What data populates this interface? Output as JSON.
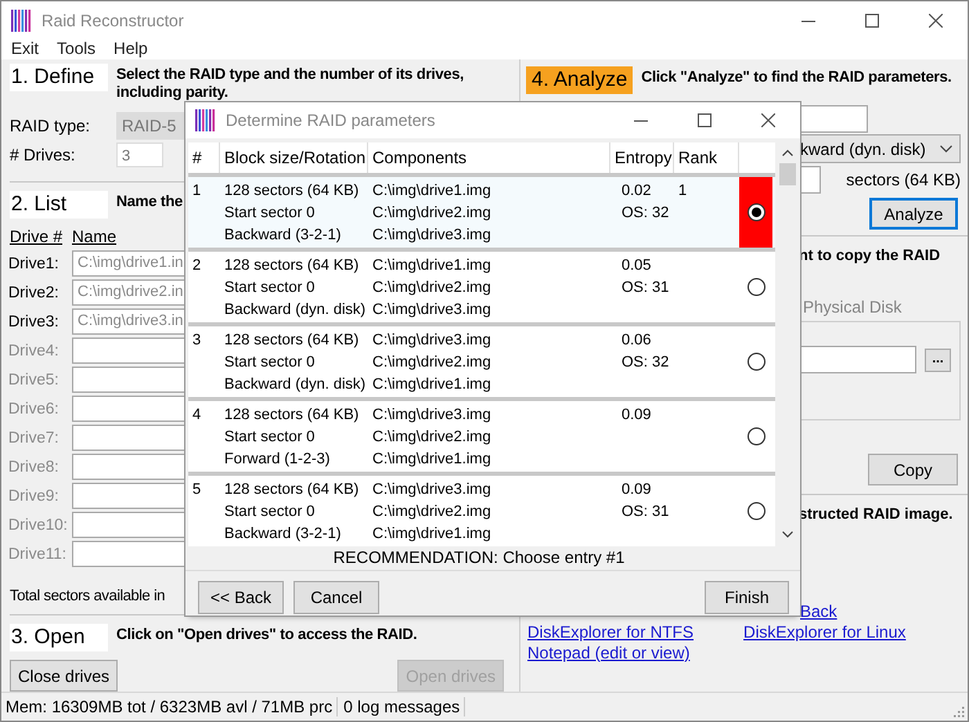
{
  "window": {
    "title": "Raid Reconstructor"
  },
  "menu": [
    "Exit",
    "Tools",
    "Help"
  ],
  "define": {
    "step": "1. Define",
    "instruction": "Select the RAID type and the number of its drives, including parity.",
    "raid_type": {
      "label": "RAID type:",
      "value": "RAID-5"
    },
    "drive_count": {
      "label": "# Drives:",
      "value": "3"
    }
  },
  "list": {
    "step": "2. List",
    "instruction": "Name the",
    "columns": [
      "Drive #",
      "Name"
    ],
    "drives": [
      {
        "label": "Drive1:",
        "value": "C:\\img\\drive1.in",
        "disabled": false
      },
      {
        "label": "Drive2:",
        "value": "C:\\img\\drive2.in",
        "disabled": false
      },
      {
        "label": "Drive3:",
        "value": "C:\\img\\drive3.in",
        "disabled": false
      },
      {
        "label": "Drive4:",
        "disabled": true
      },
      {
        "label": "Drive5:",
        "disabled": true
      },
      {
        "label": "Drive6:",
        "disabled": true
      },
      {
        "label": "Drive7:",
        "disabled": true
      },
      {
        "label": "Drive8:",
        "disabled": true
      },
      {
        "label": "Drive9:",
        "disabled": true
      },
      {
        "label": "Drive10:",
        "disabled": true
      },
      {
        "label": "Drive11:",
        "disabled": true
      }
    ],
    "total": "Total sectors available in"
  },
  "open": {
    "step": "3. Open",
    "instruction": "Click on \"Open drives\" to access the RAID.",
    "buttons": [
      {
        "label": "Close drives",
        "disabled": false
      },
      {
        "label": "Open drives",
        "disabled": true
      }
    ]
  },
  "analyze": {
    "step": "4. Analyze",
    "instruction": "Click \"Analyze\" to find the RAID parameters.",
    "rotation": "kward (dyn. disk)",
    "block_unit": "sectors (64 KB)",
    "button": "Analyze"
  },
  "copy": {
    "instruction": "nt to copy the RAID",
    "target_label": "Physical Disk",
    "browse": "...",
    "button": "Copy"
  },
  "explore": {
    "instruction": "structed RAID image.",
    "links": [
      "Back",
      "DiskExplorer for NTFS",
      "DiskExplorer for Linux",
      "Notepad (edit or view)"
    ]
  },
  "status_bar": [
    "Mem: 16309MB tot / 6323MB avl / 71MB prc",
    "0 log messages"
  ],
  "dialog": {
    "title": "Determine RAID parameters",
    "columns": [
      "#",
      "Block size/Rotation",
      "Components",
      "Entropy",
      "Rank"
    ],
    "rows": [
      {
        "number": "1",
        "block": "128 sectors (64 KB)",
        "start": "Start sector 0",
        "rotation": "Backward (3-2-1)",
        "components": [
          "C:\\img\\drive1.img",
          "C:\\img\\drive2.img",
          "C:\\img\\drive3.img"
        ],
        "entropy": "0.02",
        "os": "OS: 32",
        "rank": "1",
        "selected": true
      },
      {
        "number": "2",
        "block": "128 sectors (64 KB)",
        "start": "Start sector 0",
        "rotation": "Backward (dyn. disk)",
        "components": [
          "C:\\img\\drive1.img",
          "C:\\img\\drive2.img",
          "C:\\img\\drive3.img"
        ],
        "entropy": "0.05",
        "os": "OS: 31",
        "selected": false
      },
      {
        "number": "3",
        "block": "128 sectors (64 KB)",
        "start": "Start sector 0",
        "rotation": "Backward (dyn. disk)",
        "components": [
          "C:\\img\\drive3.img",
          "C:\\img\\drive2.img",
          "C:\\img\\drive1.img"
        ],
        "entropy": "0.06",
        "os": "OS: 32",
        "selected": false
      },
      {
        "number": "4",
        "block": "128 sectors (64 KB)",
        "start": "Start sector 0",
        "rotation": "Forward (1-2-3)",
        "components": [
          "C:\\img\\drive3.img",
          "C:\\img\\drive2.img",
          "C:\\img\\drive1.img"
        ],
        "entropy": "0.09",
        "selected": false
      },
      {
        "number": "5",
        "block": "128 sectors (64 KB)",
        "start": "Start sector 0",
        "rotation": "Backward (3-2-1)",
        "components": [
          "C:\\img\\drive3.img",
          "C:\\img\\drive2.img",
          "C:\\img\\drive1.img"
        ],
        "entropy": "0.09",
        "os": "OS: 31",
        "selected": false
      }
    ],
    "recommendation": "RECOMMENDATION: Choose entry #1",
    "buttons": [
      "<< Back",
      "Cancel",
      "Finish"
    ]
  }
}
